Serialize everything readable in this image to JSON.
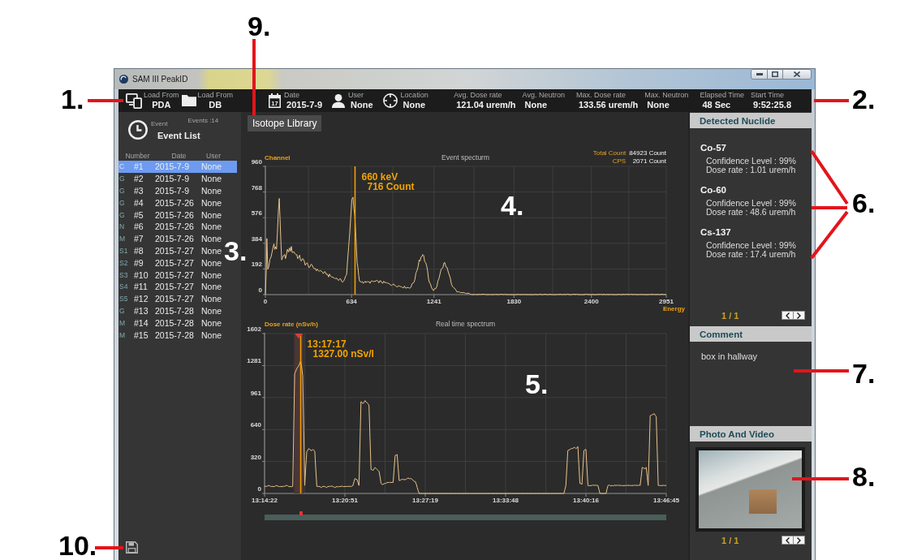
{
  "callouts": [
    "1.",
    "2.",
    "3.",
    "4.",
    "5.",
    "6.",
    "7.",
    "8.",
    "9.",
    "10."
  ],
  "window": {
    "title": "SAM III PeakID"
  },
  "toolbar": {
    "load_buttons": [
      {
        "kind": "devices",
        "label": "Load From",
        "value": "PDA"
      },
      {
        "kind": "folder",
        "label": "Load From",
        "value": "DB"
      }
    ],
    "info": [
      {
        "kind": "date",
        "label": "Date",
        "value": "2015-7-9",
        "icon_day": "17"
      },
      {
        "kind": "user",
        "label": "User",
        "value": "None"
      },
      {
        "kind": "location",
        "label": "Location",
        "value": "None"
      }
    ],
    "readings": [
      {
        "items": [
          {
            "label": "Avg. Dose rate",
            "value": "121.04 urem/h"
          },
          {
            "label": "Avg. Neutron",
            "value": "None"
          }
        ]
      },
      {
        "items": [
          {
            "label": "Max. Dose rate",
            "value": "133.56 urem/h"
          },
          {
            "label": "Max. Neutron",
            "value": "None"
          }
        ]
      },
      {
        "items": [
          {
            "label": "Elapsed Time",
            "value": "48 Sec"
          },
          {
            "label": "Start Time",
            "value": "9:52:25.8"
          }
        ]
      }
    ]
  },
  "event_list": {
    "caption": "Event",
    "count": "Events :14",
    "title": "Event List",
    "columns": [
      "Number",
      "Date",
      "User"
    ],
    "rows": [
      {
        "tag": "C",
        "number": "#1",
        "date": "2015-7-9",
        "user": "None",
        "selected": true
      },
      {
        "tag": "G",
        "number": "#2",
        "date": "2015-7-9",
        "user": "None",
        "selected": false
      },
      {
        "tag": "G",
        "number": "#3",
        "date": "2015-7-9",
        "user": "None",
        "selected": false
      },
      {
        "tag": "G",
        "number": "#4",
        "date": "2015-7-26",
        "user": "None",
        "selected": false
      },
      {
        "tag": "G",
        "number": "#5",
        "date": "2015-7-26",
        "user": "None",
        "selected": false
      },
      {
        "tag": "N",
        "number": "#6",
        "date": "2015-7-26",
        "user": "None",
        "selected": false
      },
      {
        "tag": "M",
        "number": "#7",
        "date": "2015-7-26",
        "user": "None",
        "selected": false
      },
      {
        "tag": "S1",
        "number": "#8",
        "date": "2015-7-27",
        "user": "None",
        "selected": false
      },
      {
        "tag": "S2",
        "number": "#9",
        "date": "2015-7-27",
        "user": "None",
        "selected": false
      },
      {
        "tag": "S3",
        "number": "#10",
        "date": "2015-7-27",
        "user": "None",
        "selected": false
      },
      {
        "tag": "S4",
        "number": "#11",
        "date": "2015-7-27",
        "user": "None",
        "selected": false
      },
      {
        "tag": "S5",
        "number": "#12",
        "date": "2015-7-27",
        "user": "None",
        "selected": false
      },
      {
        "tag": "G",
        "number": "#13",
        "date": "2015-7-28",
        "user": "None",
        "selected": false
      },
      {
        "tag": "M",
        "number": "#14",
        "date": "2015-7-28",
        "user": "None",
        "selected": false
      },
      {
        "tag": "M",
        "number": "#15",
        "date": "2015-7-28",
        "user": "None",
        "selected": false
      }
    ]
  },
  "isotope_library_button": "Isotope Library",
  "event_spectrum": {
    "stats": [
      {
        "label": "Total Count",
        "value": "84923 Count"
      },
      {
        "label": "CPS",
        "value": "2071 Count"
      }
    ],
    "chart_data": {
      "type": "line",
      "title": "Event specturm",
      "xlabel": "Energy",
      "ylabel": "Channel",
      "grid": true,
      "x": [
        0,
        7,
        11,
        18,
        41,
        63,
        82,
        102,
        120,
        155,
        178,
        211,
        245,
        314,
        382,
        450,
        518,
        575,
        598,
        620,
        636,
        645,
        658,
        675,
        693,
        741,
        828,
        914,
        1002,
        1067,
        1100,
        1132,
        1158,
        1180,
        1208,
        1237,
        1262,
        1294,
        1321,
        1346,
        1378,
        1410,
        1473,
        1558,
        2951
      ],
      "values": [
        0,
        200,
        420,
        190,
        280,
        380,
        340,
        720,
        260,
        300,
        350,
        320,
        280,
        220,
        190,
        150,
        120,
        100,
        150,
        450,
        710,
        730,
        600,
        240,
        100,
        90,
        100,
        80,
        60,
        50,
        110,
        260,
        300,
        240,
        90,
        30,
        60,
        190,
        240,
        170,
        60,
        20,
        10,
        0,
        0
      ],
      "xlim": [
        0,
        2951
      ],
      "ylim": [
        0,
        960
      ],
      "xticks": [
        0,
        634,
        1241,
        1830,
        2400,
        2951
      ],
      "yticks": [
        0,
        192,
        384,
        576,
        768,
        960
      ],
      "ref_lines": [
        {
          "axis": "x",
          "value": 660
        }
      ],
      "annotations": [
        {
          "x": 660,
          "text": "660 keV"
        },
        {
          "x": 660,
          "text": "716 Count"
        }
      ]
    }
  },
  "realtime_spectrum": {
    "chart_data": {
      "type": "line",
      "title": "Real time spectrum",
      "ylabel": "Dose rate (nSv/h)",
      "grid": true,
      "categories": [
        "13:14:22",
        null,
        null,
        null,
        null,
        null,
        null,
        null,
        null,
        null,
        null,
        null,
        null,
        null,
        null,
        null,
        null,
        null,
        null,
        null,
        null,
        null,
        null,
        null,
        null,
        null,
        null,
        null,
        null,
        null,
        null,
        null,
        null,
        null,
        null,
        null,
        null,
        null,
        null,
        null,
        "13:20:51",
        null,
        null,
        null,
        null,
        null,
        null,
        null,
        null,
        null,
        null,
        null,
        null,
        null,
        null,
        null,
        null,
        null,
        null,
        null,
        null,
        null,
        null,
        null,
        null,
        null,
        null,
        null,
        null,
        null,
        null,
        null,
        null,
        null,
        null,
        null,
        null,
        null,
        null,
        null,
        "13:27:19",
        null,
        null,
        null,
        null,
        null,
        null,
        null,
        null,
        null,
        null,
        null,
        null,
        null,
        null,
        null,
        null,
        null,
        null,
        null,
        null,
        null,
        null,
        null,
        null,
        null,
        null,
        null,
        null,
        null,
        null,
        null,
        null,
        null,
        null,
        null,
        null,
        null,
        null,
        null,
        "13:33:48",
        null,
        null,
        null,
        null,
        null,
        null,
        null,
        null,
        null,
        null,
        null,
        null,
        null,
        null,
        null,
        null,
        null,
        null,
        null,
        null,
        null,
        null,
        null,
        null,
        null,
        null,
        null,
        null,
        null,
        null,
        null,
        null,
        null,
        null,
        null,
        null,
        null,
        null,
        null,
        "13:40:16",
        null,
        null,
        null,
        null,
        null,
        null,
        null,
        null,
        null,
        null,
        null,
        null,
        null,
        null,
        null,
        null,
        null,
        null,
        null,
        null,
        null,
        null,
        null,
        null,
        null,
        null,
        null,
        null,
        null,
        null,
        null,
        null,
        null,
        null,
        null,
        null,
        null,
        null,
        null,
        "13:46:45"
      ],
      "values": [
        70,
        70,
        80,
        70,
        70,
        70,
        80,
        70,
        70,
        70,
        70,
        80,
        70,
        70,
        70,
        1200,
        1250,
        1280,
        1330,
        1180,
        80,
        420,
        450,
        430,
        440,
        420,
        70,
        70,
        60,
        70,
        70,
        60,
        70,
        70,
        70,
        60,
        70,
        70,
        70,
        70,
        70,
        70,
        70,
        70,
        80,
        150,
        140,
        80,
        920,
        900,
        930,
        910,
        880,
        240,
        230,
        260,
        240,
        220,
        100,
        90,
        100,
        110,
        110,
        110,
        110,
        380,
        390,
        130,
        140,
        140,
        140,
        150,
        150,
        150,
        130,
        120,
        60,
        0,
        0,
        0,
        0,
        0,
        0,
        0,
        0,
        0,
        0,
        0,
        0,
        0,
        0,
        0,
        0,
        0,
        0,
        0,
        0,
        0,
        0,
        0,
        0,
        0,
        0,
        0,
        0,
        0,
        0,
        0,
        0,
        0,
        0,
        0,
        0,
        0,
        0,
        0,
        0,
        0,
        0,
        0,
        0,
        0,
        0,
        0,
        0,
        0,
        0,
        0,
        0,
        0,
        0,
        0,
        0,
        0,
        0,
        0,
        0,
        0,
        0,
        0,
        0,
        0,
        0,
        0,
        0,
        0,
        0,
        0,
        0,
        0,
        80,
        430,
        440,
        450,
        460,
        450,
        470,
        100,
        90,
        430,
        440,
        80,
        80,
        80,
        80,
        80,
        80,
        0,
        0,
        0,
        0,
        80,
        80,
        80,
        80,
        80,
        80,
        80,
        80,
        80,
        80,
        80,
        80,
        80,
        80,
        80,
        80,
        80,
        260,
        250,
        260,
        80,
        780,
        790,
        800,
        770,
        80,
        80,
        80,
        80,
        80
      ],
      "ylim": [
        0,
        1602
      ],
      "yticks": [
        0,
        320,
        640,
        961,
        1281,
        1602
      ],
      "annotations": [
        "13:17:17",
        "1327.00 nSv/l"
      ]
    },
    "timeline": {
      "level": 0.09
    }
  },
  "detected_nuclide": {
    "title": "Detected Nuclide",
    "items": [
      {
        "name": "Co-57",
        "confidence": "Confidence Level : 99%",
        "dose_rate": "Dose rate : 1.01 urem/h"
      },
      {
        "name": "Co-60",
        "confidence": "Confidence Level : 99%",
        "dose_rate": "Dose rate : 48.6 urem/h"
      },
      {
        "name": "Cs-137",
        "confidence": "Confidence Level : 99%",
        "dose_rate": "Dose rate : 17.4 urem/h"
      }
    ],
    "page": "1 / 1"
  },
  "comment": {
    "title": "Comment",
    "text": "box in hallway"
  },
  "photo_and_video": {
    "title": "Photo And Video",
    "page": "1 / 1"
  }
}
